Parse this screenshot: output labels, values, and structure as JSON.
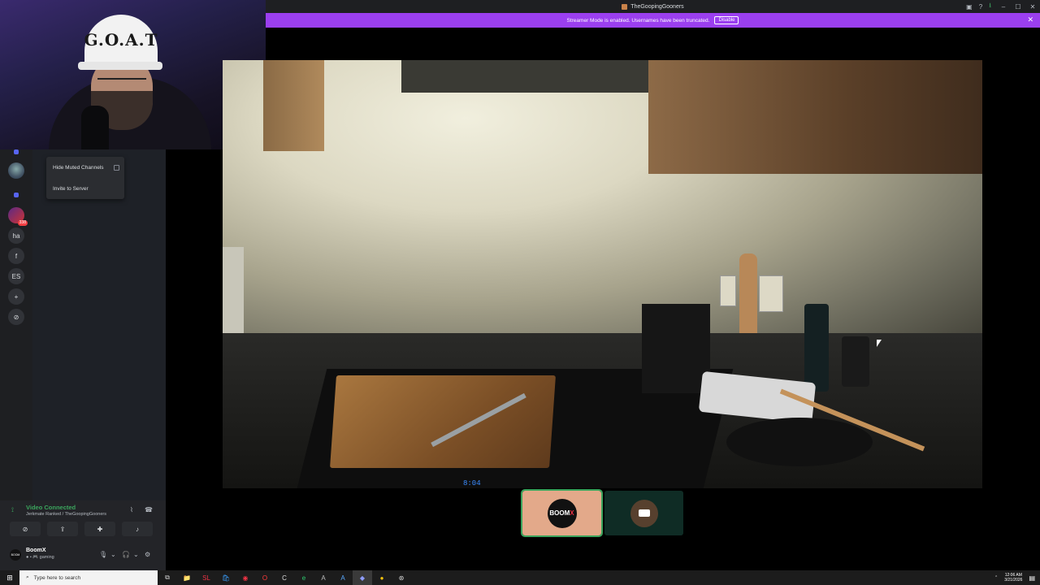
{
  "window": {
    "title": "TheGoopingGooners",
    "minimize": "–",
    "maximize": "☐",
    "close": "✕",
    "inbox_icon": "▣",
    "help_icon": "?",
    "download_icon": "⭳"
  },
  "banner": {
    "message": "Streamer Mode is enabled. Usernames have been truncated.",
    "button": "Disable",
    "close": "✕",
    "color": "#9b3ff0"
  },
  "webcam": {
    "cap_text": "G.O.A.T"
  },
  "server_rail": {
    "items": [
      {
        "label": "",
        "icon": "dm-icon"
      },
      {
        "label": "",
        "icon": "server-avatar-1"
      },
      {
        "label": "",
        "icon": "folder-icon"
      },
      {
        "label": "",
        "icon": "server-avatar-2",
        "badge": "338"
      },
      {
        "label": "ha"
      },
      {
        "label": "f"
      },
      {
        "label": "ES"
      },
      {
        "label": "+",
        "icon": "add-server-icon"
      },
      {
        "label": "⊘",
        "icon": "explore-icon"
      }
    ]
  },
  "context_menu": {
    "items": [
      {
        "label": "Hide Muted Channels",
        "checkbox": true
      },
      {
        "label": "Invite to Server"
      }
    ]
  },
  "stream": {
    "stove_clock": "8:04"
  },
  "tiles": [
    {
      "label_main": "BOOM",
      "label_accent": "X",
      "color": "#e3a98a"
    },
    {
      "label_main": "",
      "color": "#0f2c25"
    }
  ],
  "voice": {
    "status": "Video Connected",
    "channel": "Jerkmate Ranked / TheGoopingGooners",
    "status_color": "#3ba55d",
    "signal_icon": "⟟",
    "noise_icon": "⌇",
    "disconnect_icon": "☎",
    "buttons": [
      {
        "icon": "camera-off-icon",
        "glyph": "⊘"
      },
      {
        "icon": "screen-share-icon",
        "glyph": "⇪"
      },
      {
        "icon": "activities-icon",
        "glyph": "✚"
      },
      {
        "icon": "soundboard-icon",
        "glyph": "♪"
      }
    ]
  },
  "user": {
    "avatar_text": "BOOM",
    "name": "BoomX",
    "status": "● • 🎮 gaming",
    "mic_icon": "🎙",
    "mic_caret": "⌄",
    "headset_icon": "🎧",
    "headset_caret": "⌄",
    "settings_icon": "⚙"
  },
  "taskbar": {
    "start": "⊞",
    "search_placeholder": "Type here to search",
    "search_icon": "⌕",
    "apps": [
      "⧉",
      "📁",
      "SL",
      "🛍",
      "◉",
      "O",
      "C",
      "e",
      "A",
      "A",
      "◆",
      "●",
      "⊛"
    ],
    "tray_arrow": "⌃",
    "time": "12:06 AM",
    "date": "3/21/2026",
    "notif_icon": "▤"
  }
}
